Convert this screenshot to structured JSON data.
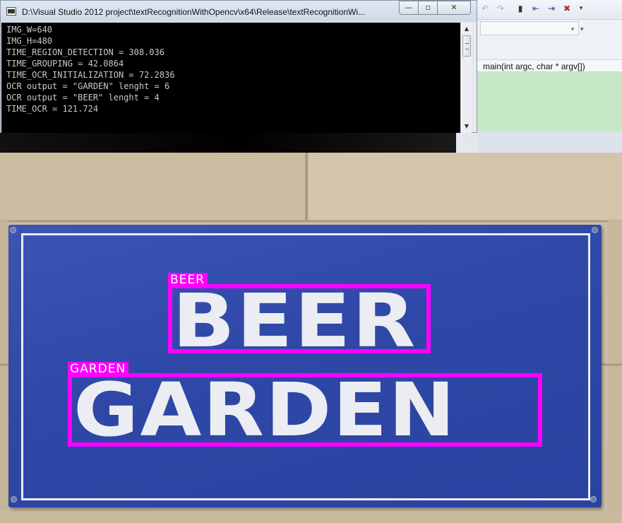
{
  "console": {
    "title": "D:\\Visual Studio 2012 project\\textRecognitionWithOpencv\\x64\\Release\\textRecognitionWi...",
    "lines": [
      "IMG_W=640",
      "IMG_H=480",
      "TIME_REGION_DETECTION = 308.036",
      "TIME_GROUPING = 42.0864",
      "TIME_OCR_INITIALIZATION = 72.2836",
      "OCR output = \"GARDEN\" lenght = 6",
      "OCR output = \"BEER\" lenght = 4",
      "TIME_OCR = 121.724"
    ],
    "caption_buttons": {
      "minimize": "—",
      "maximize": "▫",
      "close": "✕"
    }
  },
  "ide": {
    "nav_function": "main(int argc, char * argv[])",
    "toolbar_icons": [
      "undo-icon",
      "redo-icon",
      "bookmark-icon",
      "bookmark-prev-icon",
      "bookmark-next-icon",
      "bookmark-clear-icon",
      "overflow-icon"
    ],
    "editor_bg": "#c7e8c5"
  },
  "image": {
    "sign_text": {
      "line1": "BEER",
      "line2": "GARDEN"
    },
    "detections": [
      {
        "label": "BEER"
      },
      {
        "label": "GARDEN"
      }
    ],
    "colors": {
      "sign_blue": "#2f48a7",
      "detection_magenta": "#ff00ff",
      "wall": "#cdbfa5"
    }
  }
}
